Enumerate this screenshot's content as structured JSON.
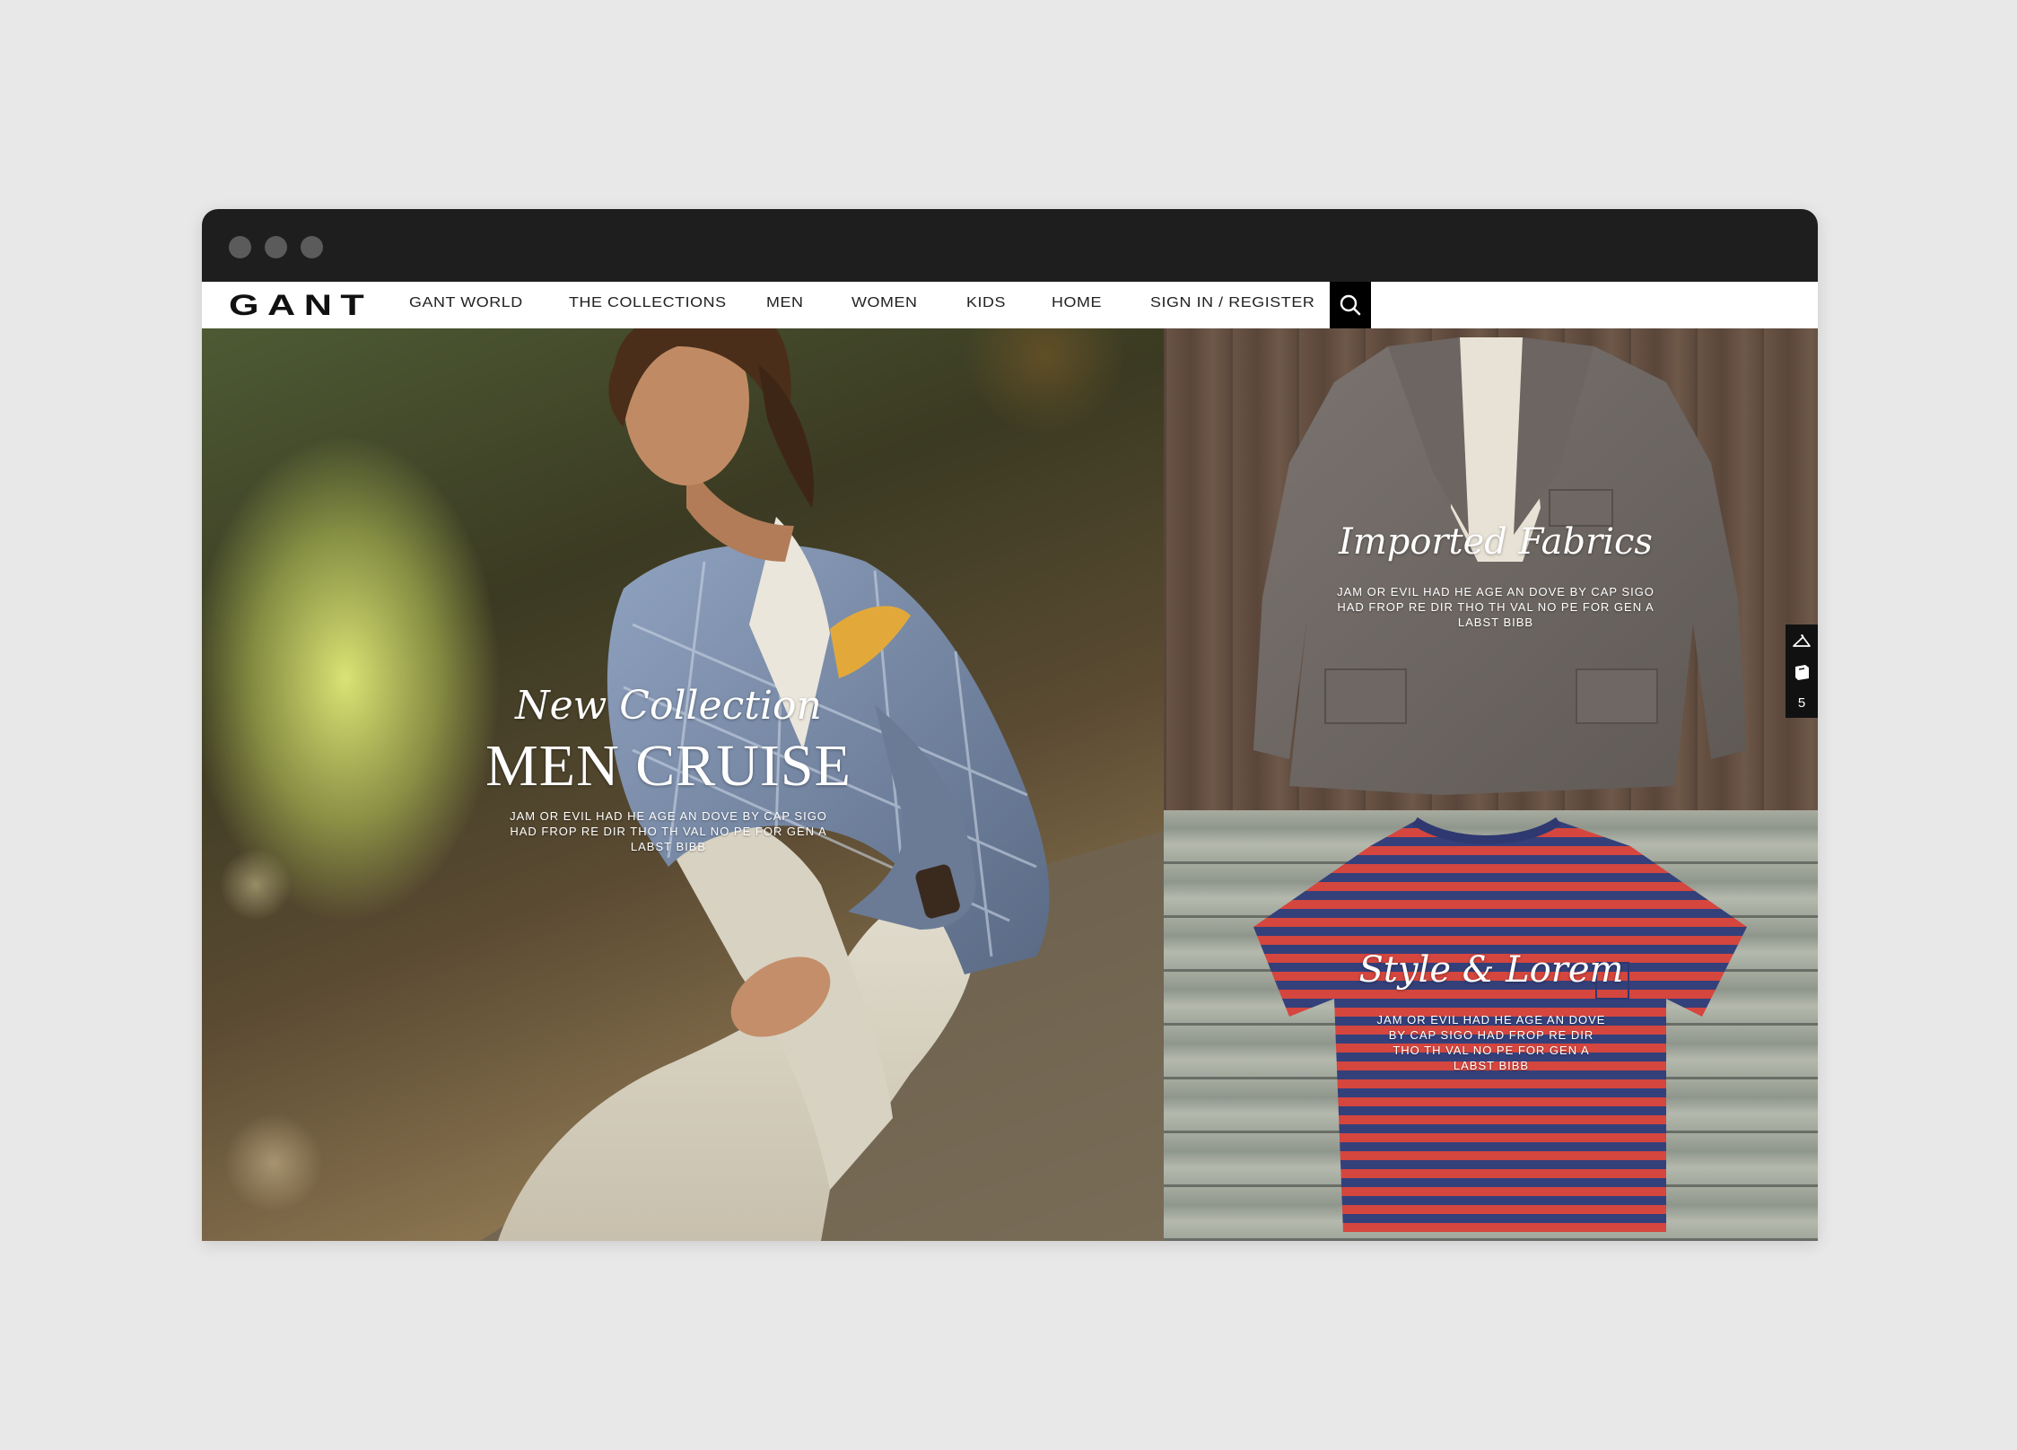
{
  "brand": {
    "logo": "GANT"
  },
  "nav": {
    "items": [
      {
        "label": "GANT WORLD"
      },
      {
        "label": "THE COLLECTIONS"
      },
      {
        "label": "MEN"
      },
      {
        "label": "WOMEN"
      },
      {
        "label": "KIDS"
      },
      {
        "label": "HOME"
      },
      {
        "label": "SIGN IN / REGISTER"
      }
    ],
    "search_icon": "search-icon"
  },
  "hero": {
    "script_title": "New Collection",
    "title": "MEN CRUISE",
    "body_lines": [
      "JAM OR EVIL HAD HE AGE AN DOVE BY CAP SIGO",
      "HAD FROP RE DIR THO TH VAL NO PE FOR GEN A",
      "LABST BIBB"
    ]
  },
  "panel_jacket": {
    "script_title": "Imported Fabrics",
    "body_lines": [
      "JAM OR EVIL HAD HE AGE AN DOVE BY CAP SIGO",
      "HAD FROP RE DIR THO TH VAL NO PE FOR GEN A",
      "LABST BIBB"
    ]
  },
  "panel_tee": {
    "script_title": "Style & Lorem",
    "body_lines": [
      "JAM OR EVIL HAD HE AGE AN DOVE",
      "BY CAP SIGO HAD FROP RE DIR",
      "THO TH VAL NO PE FOR GEN A",
      "LABST BIBB"
    ]
  },
  "sidebar": {
    "icons": [
      "hanger-icon",
      "bag-icon"
    ],
    "count": "5"
  },
  "colors": {
    "titlebar": "#1e1e1e",
    "navbar": "#ffffff",
    "search_bg": "#000000",
    "tee_red": "#d4463e",
    "tee_navy": "#34407a"
  }
}
